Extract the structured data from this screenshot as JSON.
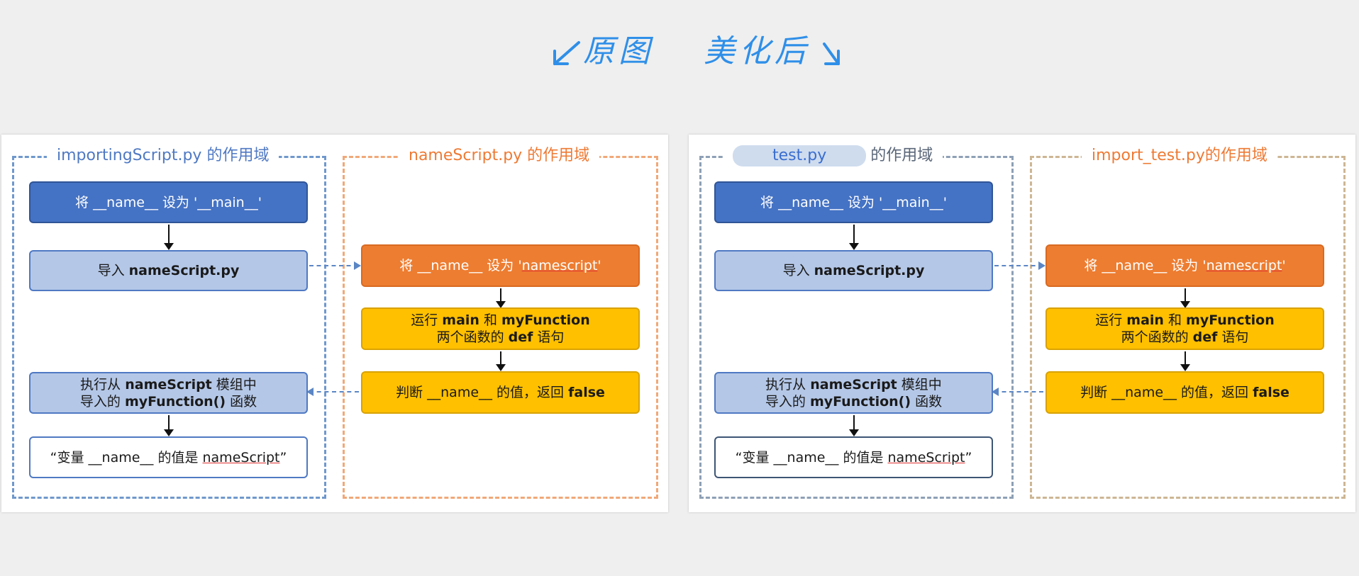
{
  "header": {
    "original_label": "原图",
    "beautified_label": "美化后"
  },
  "panels": {
    "original": {
      "scope_left_title": "importingScript.py 的作用域",
      "scope_right_title": "nameScript.py 的作用域",
      "set_main": "将 __name__ 设为 '__main__'",
      "import_prefix": "导入 ",
      "import_module": "nameScript.py",
      "set_name_prefix": "将 __name__ 设为 '",
      "set_name_value": "namescript",
      "set_name_suffix": "'",
      "run_line1_pre": "运行 ",
      "run_line1_a": "main",
      "run_line1_mid": " 和 ",
      "run_line1_b": "myFunction",
      "run_line2_pre": "两个函数的 ",
      "run_line2_b": "def",
      "run_line2_post": " 语句",
      "judge_pre": "判断 __name__ 的值，返回 ",
      "judge_value": "false",
      "exec_line1_pre": "执行从 ",
      "exec_line1_b": "nameScript",
      "exec_line1_post": " 模组中",
      "exec_line2_pre": "导入的 ",
      "exec_line2_b": "myFunction()",
      "exec_line2_post": " 函数",
      "output_pre": "“变量 __name__ 的值是 ",
      "output_value": "nameScript",
      "output_post": "”"
    },
    "beautified": {
      "scope_left_title_highlight": "test.py",
      "scope_left_title_rest": "的作用域",
      "scope_right_title": "import_test.py的作用域",
      "set_main": "将 __name__ 设为 '__main__'",
      "import_prefix": "导入 ",
      "import_module": "nameScript.py",
      "set_name_prefix": "将 __name__ 设为 '",
      "set_name_value": "namescript",
      "set_name_suffix": "'",
      "run_line1_pre": "运行 ",
      "run_line1_a": "main",
      "run_line1_mid": " 和 ",
      "run_line1_b": "myFunction",
      "run_line2_pre": "两个函数的 ",
      "run_line2_b": "def",
      "run_line2_post": " 语句",
      "judge_pre": "判断 __name__ 的值，返回 ",
      "judge_value": "false",
      "exec_line1_pre": "执行从 ",
      "exec_line1_b": "nameScript",
      "exec_line1_post": " 模组中",
      "exec_line2_pre": "导入的 ",
      "exec_line2_b": "myFunction()",
      "exec_line2_post": " 函数",
      "output_pre": "“变量 __name__ 的值是 ",
      "output_value": "nameScript",
      "output_post": "”"
    }
  },
  "colors": {
    "box_dark_blue": "#4472c4",
    "box_light_blue": "#b4c7e7",
    "box_orange": "#ed7d31",
    "box_yellow": "#ffc000",
    "header_blue": "#2f8fe8"
  }
}
